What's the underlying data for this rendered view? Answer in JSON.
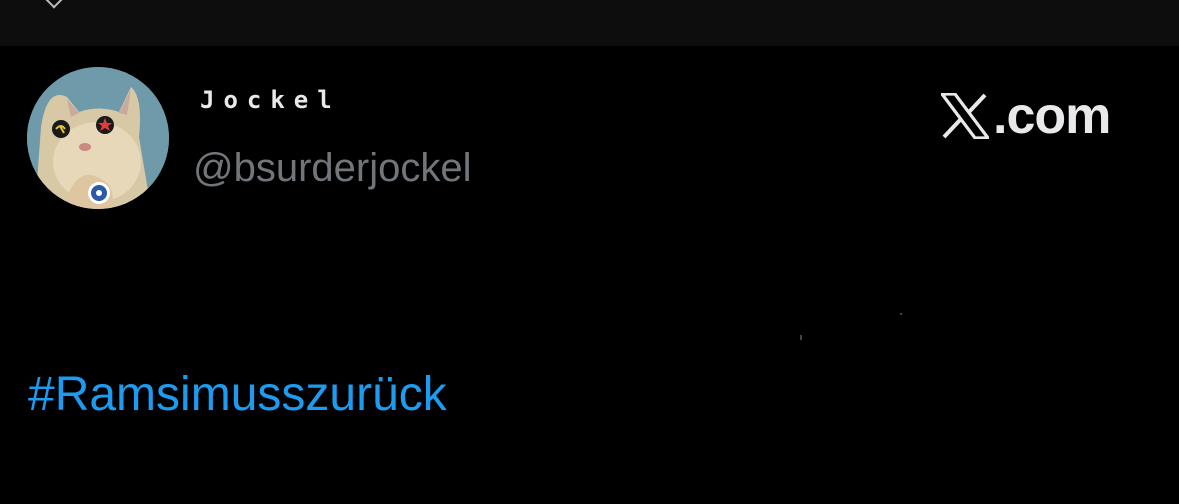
{
  "profile": {
    "display_name": "Jockel",
    "handle": "@bsurderjockel",
    "avatar_icon": "cat-avatar-icon"
  },
  "branding": {
    "x_icon": "x-logo-icon",
    "domain": ".com"
  },
  "post": {
    "hashtag": "#Ramsimusszurück"
  },
  "colors": {
    "background": "#000000",
    "topbar": "#0d0d0d",
    "name": "#e7e9ea",
    "handle": "#71767b",
    "link": "#1d9bf0"
  }
}
